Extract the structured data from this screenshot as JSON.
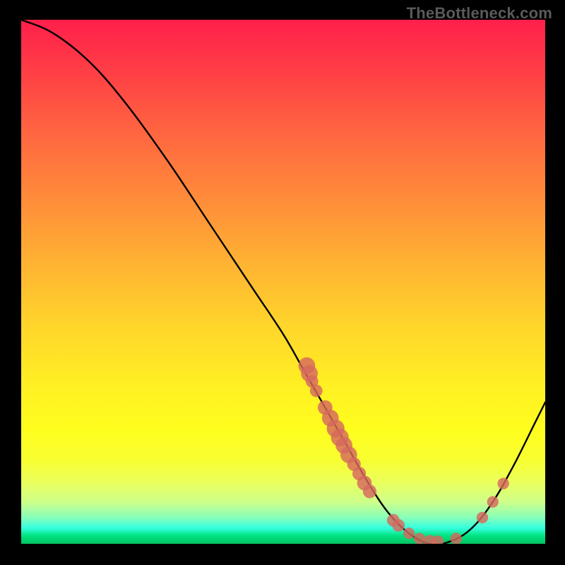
{
  "watermark": "TheBottleneck.com",
  "chart_data": {
    "type": "line",
    "title": "",
    "xlabel": "",
    "ylabel": "",
    "xlim": [
      0,
      100
    ],
    "ylim": [
      0,
      100
    ],
    "grid": false,
    "curve": [
      {
        "x": 0,
        "y": 100
      },
      {
        "x": 6,
        "y": 97.5
      },
      {
        "x": 13,
        "y": 92
      },
      {
        "x": 20,
        "y": 84
      },
      {
        "x": 28,
        "y": 73
      },
      {
        "x": 36,
        "y": 61
      },
      {
        "x": 44,
        "y": 49
      },
      {
        "x": 50,
        "y": 40
      },
      {
        "x": 54,
        "y": 33
      },
      {
        "x": 58,
        "y": 26
      },
      {
        "x": 62,
        "y": 19
      },
      {
        "x": 66,
        "y": 12
      },
      {
        "x": 70,
        "y": 6
      },
      {
        "x": 74,
        "y": 2
      },
      {
        "x": 78,
        "y": 0
      },
      {
        "x": 82,
        "y": 0.5
      },
      {
        "x": 86,
        "y": 3
      },
      {
        "x": 90,
        "y": 8
      },
      {
        "x": 94,
        "y": 15
      },
      {
        "x": 98,
        "y": 23
      },
      {
        "x": 100,
        "y": 27
      }
    ],
    "points": [
      {
        "x": 54.5,
        "y": 34,
        "r": 1.6
      },
      {
        "x": 55,
        "y": 32.5,
        "r": 1.6
      },
      {
        "x": 55.5,
        "y": 31,
        "r": 1.2
      },
      {
        "x": 56.3,
        "y": 29.2,
        "r": 1.2
      },
      {
        "x": 58,
        "y": 26,
        "r": 1.4
      },
      {
        "x": 59,
        "y": 24,
        "r": 1.6
      },
      {
        "x": 60,
        "y": 22,
        "r": 1.7
      },
      {
        "x": 60.8,
        "y": 20.3,
        "r": 1.7
      },
      {
        "x": 61.6,
        "y": 18.8,
        "r": 1.6
      },
      {
        "x": 62.5,
        "y": 17,
        "r": 1.6
      },
      {
        "x": 63.5,
        "y": 15.2,
        "r": 1.3
      },
      {
        "x": 64.5,
        "y": 13.4,
        "r": 1.3
      },
      {
        "x": 65.5,
        "y": 11.6,
        "r": 1.4
      },
      {
        "x": 66.5,
        "y": 10,
        "r": 1.3
      },
      {
        "x": 71,
        "y": 4.5,
        "r": 1.2
      },
      {
        "x": 72,
        "y": 3.5,
        "r": 1.2
      },
      {
        "x": 74,
        "y": 2,
        "r": 1.1
      },
      {
        "x": 76,
        "y": 1,
        "r": 1.1
      },
      {
        "x": 78,
        "y": 0.5,
        "r": 1.2
      },
      {
        "x": 79.5,
        "y": 0.5,
        "r": 1.1
      },
      {
        "x": 83,
        "y": 1,
        "r": 1.1
      },
      {
        "x": 88,
        "y": 5,
        "r": 1.1
      },
      {
        "x": 90,
        "y": 8,
        "r": 1.1
      },
      {
        "x": 92,
        "y": 11.5,
        "r": 1.1
      }
    ],
    "curve_color": "#000000",
    "curve_width": 2.4,
    "point_color": "#d6695e"
  }
}
